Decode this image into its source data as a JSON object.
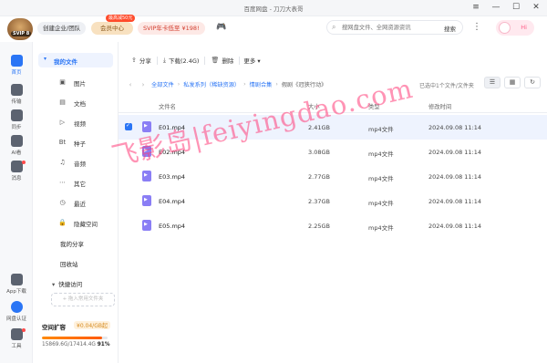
{
  "window": {
    "title": "百度网盘 - 刀刀大表哥",
    "controls": [
      "≡",
      "—",
      "☐",
      "✕"
    ]
  },
  "header": {
    "avatar_label": "SVIP 8",
    "org_label": "创建企业/团队",
    "vip_label": "会员中心",
    "vip_badge": "最高减50元",
    "svip_label": "SVIP年卡低至 ¥198!",
    "search_placeholder": "搜网盘文件、全网资源资讯",
    "search_button": "搜索",
    "more_glyph": "⋮",
    "hi_label": "Hi"
  },
  "rail": [
    {
      "label": "首页",
      "active": true
    },
    {
      "label": "传输"
    },
    {
      "label": "同步"
    },
    {
      "label": "AI看"
    },
    {
      "label": "消息",
      "dot": true
    },
    {
      "label": "App下载"
    },
    {
      "label": "网盘认证"
    },
    {
      "label": "工具",
      "dot": true
    }
  ],
  "nav": {
    "my_files": "我的文件",
    "subitems": [
      {
        "icon": "image-icon",
        "glyph": "▣",
        "label": "图片"
      },
      {
        "icon": "doc-icon",
        "glyph": "▤",
        "label": "文档"
      },
      {
        "icon": "video-icon",
        "glyph": "▷",
        "label": "视频"
      },
      {
        "icon": "bt-icon",
        "glyph": "Bt",
        "label": "种子"
      },
      {
        "icon": "audio-icon",
        "glyph": "♫",
        "label": "音频"
      },
      {
        "icon": "other-icon",
        "glyph": "⋯",
        "label": "其它"
      },
      {
        "icon": "recent-icon",
        "glyph": "◷",
        "label": "最近"
      },
      {
        "icon": "lock-icon",
        "glyph": "🔒",
        "label": "隐藏空间"
      }
    ],
    "my_share": "我的分享",
    "recycle": "回收站",
    "favorites": "快捷访问",
    "add_favorite": "+ 拖入常用文件夹",
    "space": {
      "title": "空间扩容",
      "offer": "¥0.04/GB起",
      "used": "15869.6G/17414.4G",
      "percent_label": "91%",
      "percent": 0.91
    }
  },
  "toolbar": {
    "share": "分享",
    "download": "下载(2.4G)",
    "delete": "删除",
    "more": "更多"
  },
  "breadcrumb": {
    "items": [
      "全部文件",
      "私发系列（稀缺资源）",
      "情剧合集"
    ],
    "current": "假剧《冠狭行动》",
    "selection_info": "已选中1个文件/文件夹"
  },
  "table": {
    "headers": [
      "文件名",
      "大小",
      "类型",
      "修改时间"
    ],
    "rows": [
      {
        "name": "E01.mp4",
        "size": "2.41GB",
        "type": "mp4文件",
        "date": "2024.09.08 11:14",
        "selected": true
      },
      {
        "name": "E02.mp4",
        "size": "3.08GB",
        "type": "mp4文件",
        "date": "2024.09.08 11:14",
        "selected": false
      },
      {
        "name": "E03.mp4",
        "size": "2.77GB",
        "type": "mp4文件",
        "date": "2024.09.08 11:14",
        "selected": false
      },
      {
        "name": "E04.mp4",
        "size": "2.37GB",
        "type": "mp4文件",
        "date": "2024.09.08 11:14",
        "selected": false
      },
      {
        "name": "E05.mp4",
        "size": "2.25GB",
        "type": "mp4文件",
        "date": "2024.09.08 11:14",
        "selected": false
      }
    ]
  },
  "watermark": "飞影岛|feiyingdao.com",
  "colors": {
    "accent": "#2a75f5",
    "selected_row": "#eef3fe",
    "video_icon": "#8a7ef5",
    "watermark": "#ff3c78"
  }
}
